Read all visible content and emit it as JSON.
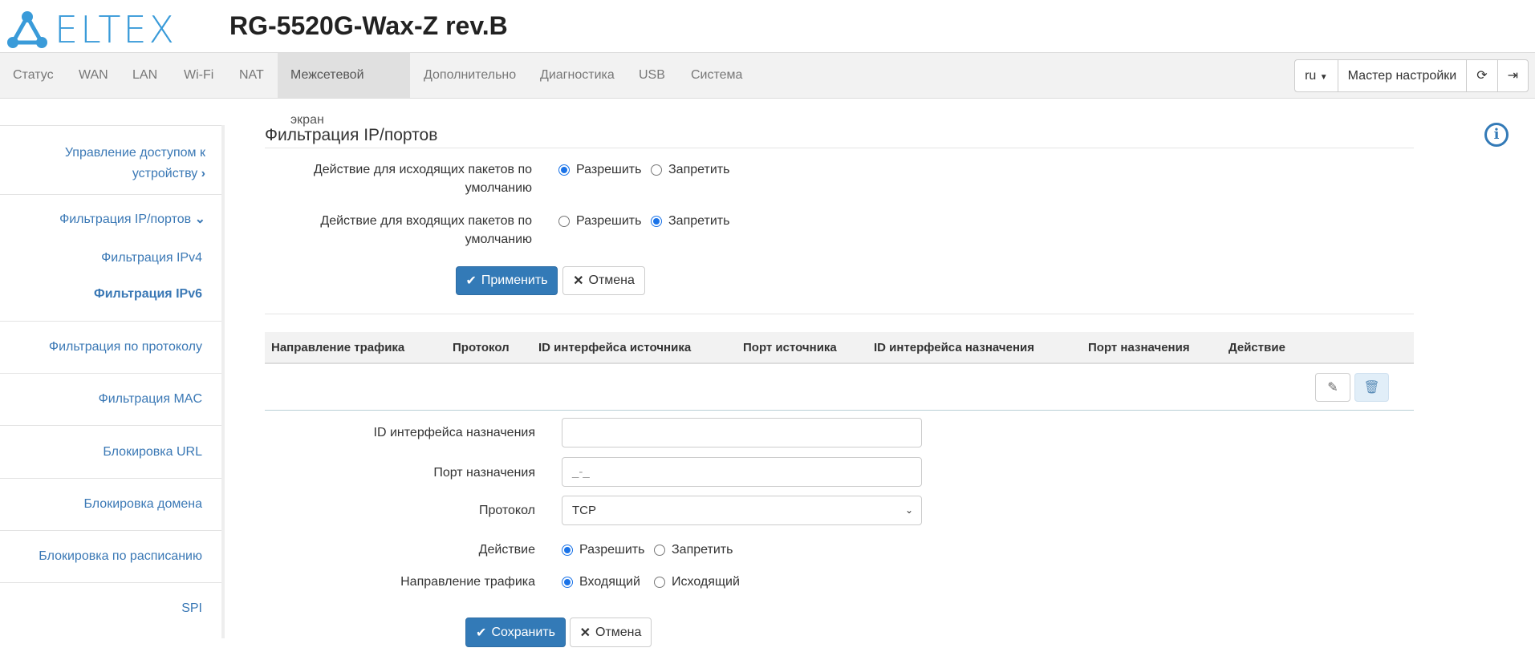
{
  "header": {
    "logo_text": "ELTEX",
    "device_title": "RG-5520G-Wax-Z rev.B"
  },
  "nav": {
    "items": [
      "Статус",
      "WAN",
      "LAN",
      "Wi-Fi",
      "NAT",
      "Межсетевой экран",
      "Дополнительно",
      "Диагностика",
      "USB",
      "Система"
    ],
    "active": "Межсетевой экран",
    "lang": "ru",
    "wizard": "Мастер настройки"
  },
  "sidebar": {
    "items": [
      "Управление доступом к устройству",
      "Фильтрация IP/портов",
      "Фильтрация IPv4",
      "Фильтрация IPv6",
      "Фильтрация по протоколу",
      "Фильтрация MAC",
      "Блокировка URL",
      "Блокировка домена",
      "Блокировка по расписанию",
      "SPI"
    ]
  },
  "main": {
    "heading": "Фильтрация IP/портов",
    "out_label": "Действие для исходящих пакетов по умолчанию",
    "in_label": "Действие для входящих пакетов по умолчанию",
    "allow": "Разрешить",
    "deny": "Запретить",
    "apply": "Применить",
    "cancel": "Отмена",
    "table_headers": [
      "Направление трафика",
      "Протокол",
      "ID интерфейса источника",
      "Порт источника",
      "ID интерфейса назначения",
      "Порт назначения",
      "Действие"
    ],
    "form": {
      "dst_if_label": "ID интерфейса назначения",
      "dst_if_value": "",
      "dst_port_label": "Порт назначения",
      "dst_port_placeholder": "_-_",
      "proto_label": "Протокол",
      "proto_value": "TCP",
      "action_label": "Действие",
      "dir_label": "Направление трафика",
      "incoming": "Входящий",
      "outgoing": "Исходящий",
      "save": "Сохранить",
      "cancel": "Отмена"
    }
  },
  "colors": {
    "accent": "#337ab7",
    "link": "#3a78b5",
    "logo": "#3a9bd9"
  }
}
